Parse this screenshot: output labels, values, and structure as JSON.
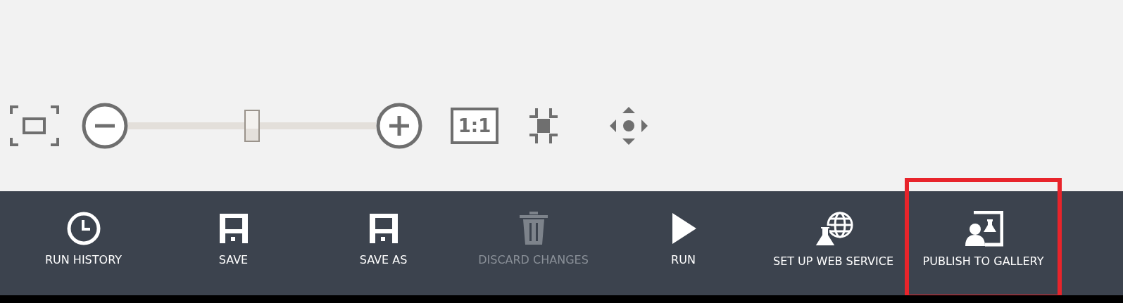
{
  "zoom_controls": {
    "slider": {
      "level": 0.5
    },
    "zoom_in": {
      "kind": "plus"
    },
    "actual_size": {
      "label": "1:1"
    }
  },
  "toolbar": {
    "buttons": [
      {
        "kind": "clock",
        "label": "RUN HISTORY",
        "disabled": false,
        "highlighted": false
      },
      {
        "kind": "floppy",
        "label": "SAVE",
        "disabled": false,
        "highlighted": false
      },
      {
        "kind": "floppy",
        "label": "SAVE AS",
        "disabled": false,
        "highlighted": false
      },
      {
        "kind": "trash",
        "label": "DISCARD CHANGES",
        "disabled": true,
        "highlighted": false
      },
      {
        "kind": "play",
        "label": "RUN",
        "disabled": false,
        "highlighted": false
      },
      {
        "kind": "flask-globe",
        "label": "SET UP WEB SERVICE",
        "disabled": false,
        "highlighted": false
      },
      {
        "kind": "publish",
        "label": "PUBLISH TO GALLERY",
        "disabled": false,
        "highlighted": true
      }
    ]
  }
}
